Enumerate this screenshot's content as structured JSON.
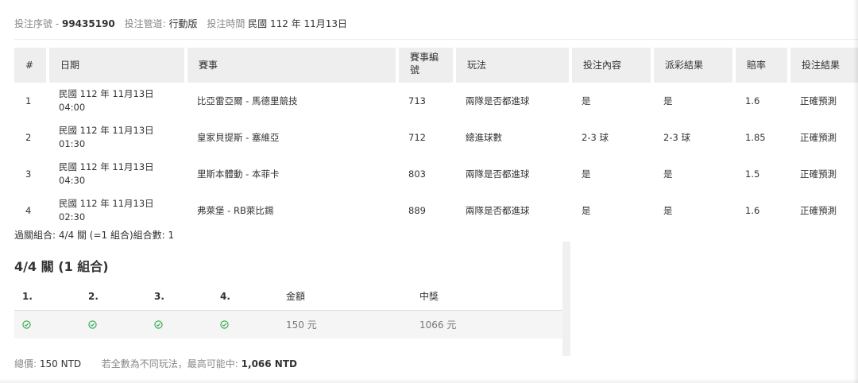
{
  "meta": {
    "serial_label": "投注序號",
    "serial_sep": " - ",
    "serial_value": "99435190",
    "channel_label": "投注管道:",
    "channel_value": "行動版",
    "time_label": "投注時間",
    "time_value": "民國 112 年 11月13日"
  },
  "bets": {
    "headers": [
      "#",
      "日期",
      "賽事",
      "賽事編號",
      "玩法",
      "投注內容",
      "派彩結果",
      "賠率",
      "投注結果"
    ],
    "rows": [
      {
        "idx": "1",
        "date": "民國 112 年 11月13日",
        "time": "04:00",
        "match": "比亞雷亞爾 - 馬德里競技",
        "code": "713",
        "play": "兩隊是否都進球",
        "pick": "是",
        "outcome": "是",
        "odds": "1.6",
        "result": "正確預測"
      },
      {
        "idx": "2",
        "date": "民國 112 年 11月13日",
        "time": "01:30",
        "match": "皇家貝提斯 - 塞維亞",
        "code": "712",
        "play": "總進球數",
        "pick": "2-3 球",
        "outcome": "2-3 球",
        "odds": "1.85",
        "result": "正確預測"
      },
      {
        "idx": "3",
        "date": "民國 112 年 11月13日",
        "time": "04:30",
        "match": "里斯本體動 - 本菲卡",
        "code": "803",
        "play": "兩隊是否都進球",
        "pick": "是",
        "outcome": "是",
        "odds": "1.5",
        "result": "正確預測"
      },
      {
        "idx": "4",
        "date": "民國 112 年 11月13日",
        "time": "02:30",
        "match": "弗萊堡 - RB萊比錫",
        "code": "889",
        "play": "兩隊是否都進球",
        "pick": "是",
        "outcome": "是",
        "odds": "1.6",
        "result": "正確預測"
      }
    ]
  },
  "summary": {
    "text": "過關組合: 4/4 關 (=1 組合)組合數: 1"
  },
  "combo": {
    "title": "4/4 關 (1 組合)",
    "headers": [
      "1.",
      "2.",
      "3.",
      "4.",
      "金額",
      "中獎"
    ],
    "amount": "150 元",
    "prize": "1066 元",
    "check_icon": "check-circle-icon",
    "check_color": "#27a844"
  },
  "footer": {
    "total_label": "總價:",
    "total_value": "150 NTD",
    "note": "若全數為不同玩法，最高可能中:",
    "max_value": "1,066 NTD"
  }
}
